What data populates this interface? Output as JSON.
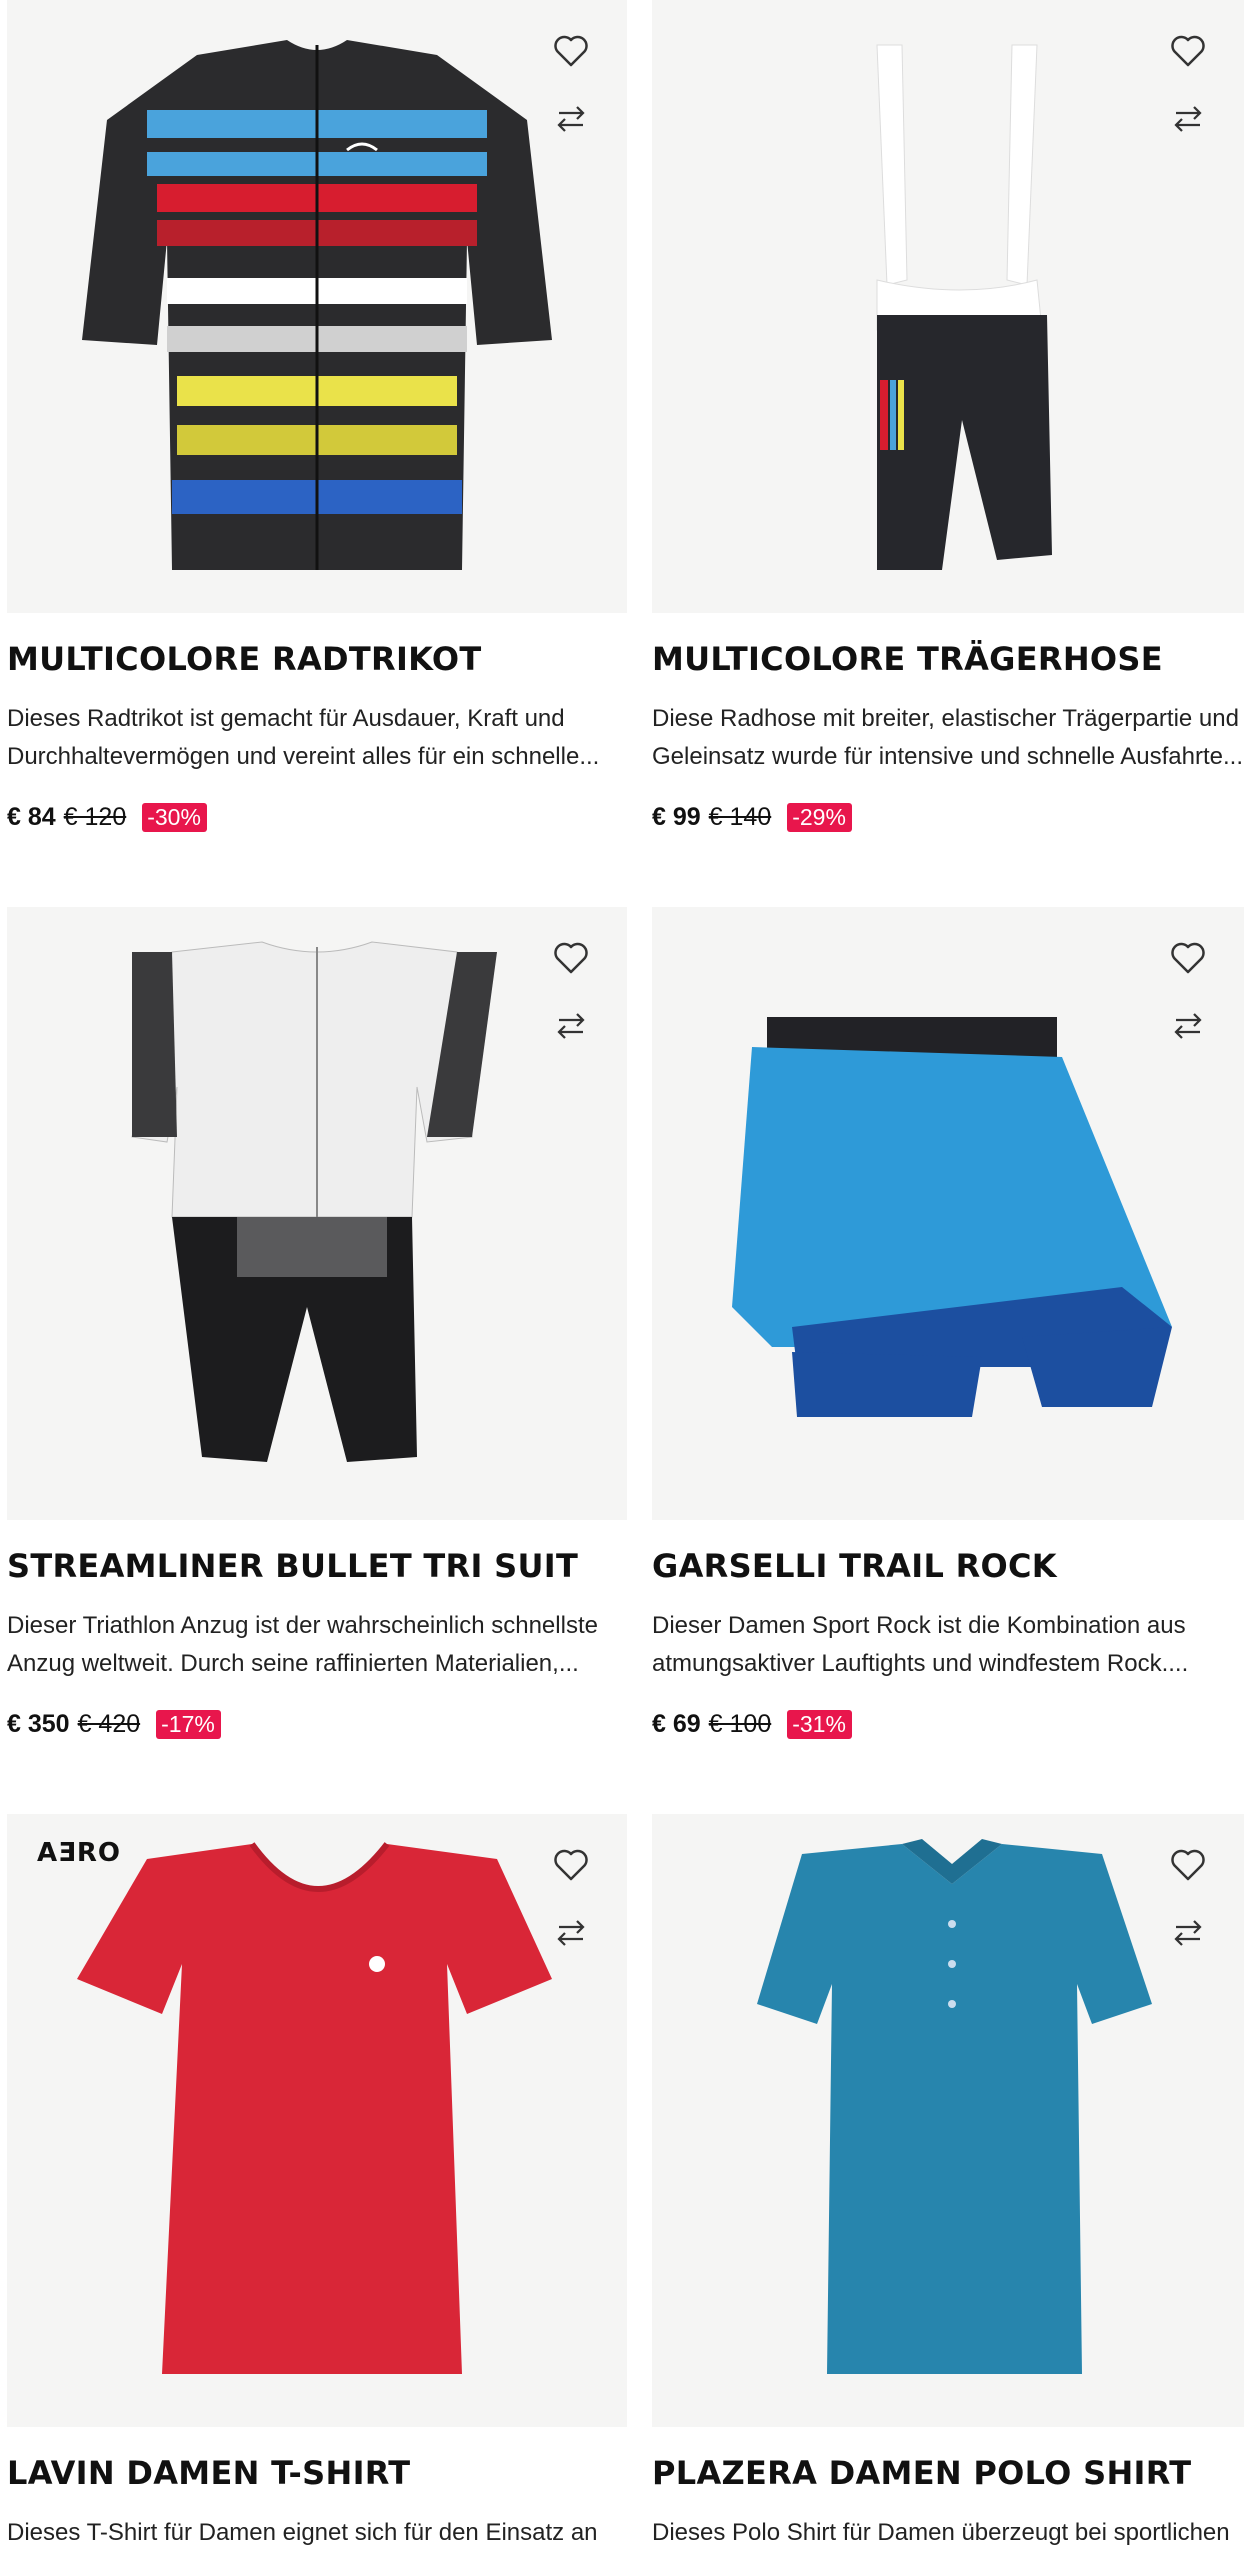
{
  "colors": {
    "discount_badge": "#e8164c",
    "image_bg": "#f5f5f4"
  },
  "icons": {
    "favorite": "heart-icon",
    "compare": "compare-arrows-icon"
  },
  "products": [
    {
      "title": "MULTICOLORE RADTRIKOT",
      "desc_line1": "Dieses Radtrikot ist gemacht für Ausdauer, Kraft und",
      "desc_line2": "Durchhaltevermögen und vereint alles für ein schnelle...",
      "price": "€ 84",
      "old_price": "€ 120",
      "discount": "-30%"
    },
    {
      "title": "MULTICOLORE TRÄGERHOSE",
      "desc_line1": "Diese Radhose mit breiter, elastischer Trägerpartie und",
      "desc_line2": "Geleinsatz wurde für intensive und schnelle Ausfahrte...",
      "price": "€ 99",
      "old_price": "€ 140",
      "discount": "-29%"
    },
    {
      "title": "STREAMLINER BULLET TRI SUIT",
      "desc_line1": "Dieser Triathlon Anzug ist der wahrscheinlich schnellste",
      "desc_line2": "Anzug weltweit. Durch seine raffinierten Materialien,...",
      "price": "€ 350",
      "old_price": "€ 420",
      "discount": "-17%"
    },
    {
      "title": "GARSELLI TRAIL ROCK",
      "desc_line1": "Dieser Damen Sport Rock ist die Kombination aus",
      "desc_line2": "atmungsaktiver Lauftights und windfestem Rock....",
      "price": "€ 69",
      "old_price": "€ 100",
      "discount": "-31%"
    },
    {
      "title": "LAVIN DAMEN T-SHIRT",
      "badge": "AƎRO",
      "desc_line1": "Dieses T-Shirt für Damen eignet sich für den Einsatz an",
      "desc_line2": ""
    },
    {
      "title": "PLAZERA DAMEN POLO SHIRT",
      "desc_line1": "Dieses Polo Shirt für Damen überzeugt bei sportlichen",
      "desc_line2": ""
    }
  ]
}
